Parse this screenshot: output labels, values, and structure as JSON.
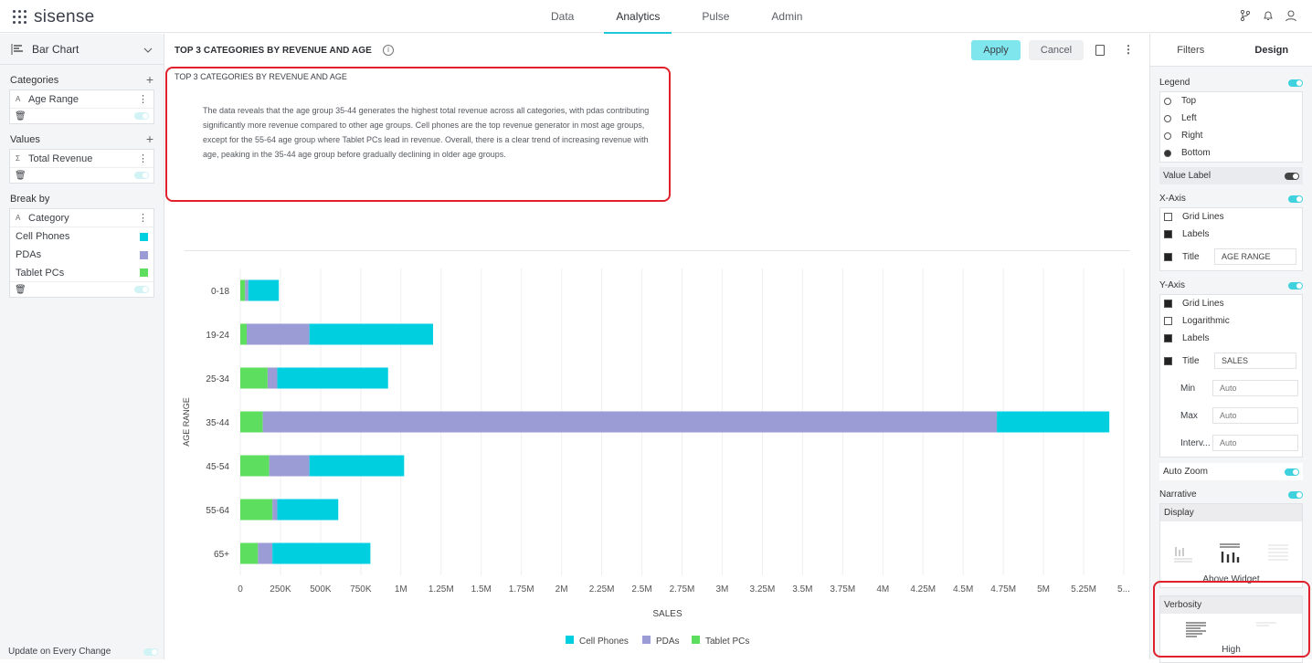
{
  "app": {
    "brand": "sisense"
  },
  "nav": [
    "Data",
    "Analytics",
    "Pulse",
    "Admin"
  ],
  "left": {
    "chart_type": "Bar Chart",
    "categories_label": "Categories",
    "categories_item": "Age Range",
    "values_label": "Values",
    "values_item": "Total Revenue",
    "breakby_label": "Break by",
    "breakby_item": "Category",
    "breakby_members": [
      {
        "name": "Cell Phones",
        "color": "#00cfe0"
      },
      {
        "name": "PDAs",
        "color": "#9b9bd6"
      },
      {
        "name": "Tablet PCs",
        "color": "#5ede5e"
      }
    ],
    "update_label": "Update on Every Change"
  },
  "main": {
    "title": "TOP 3 CATEGORIES BY REVENUE AND AGE",
    "apply": "Apply",
    "cancel": "Cancel",
    "narrative_title": "TOP 3 CATEGORIES BY REVENUE AND AGE",
    "narrative_text": "The data reveals that the age group 35-44 generates the highest total revenue across all categories, with pdas contributing significantly more revenue compared to other age groups. Cell phones are the top revenue generator in most age groups, except for the 55-64 age group where Tablet PCs lead in revenue. Overall, there is a clear trend of increasing revenue with age, peaking in the 35-44 age group before gradually declining in older age groups."
  },
  "chart_data": {
    "type": "bar",
    "orientation": "horizontal",
    "stacked": true,
    "categories": [
      "0-18",
      "19-24",
      "25-34",
      "35-44",
      "45-54",
      "55-64",
      "65+"
    ],
    "series": [
      {
        "name": "Tablet PCs",
        "color": "#5ede5e",
        "values": [
          30000,
          40000,
          170000,
          140000,
          180000,
          200000,
          110000
        ]
      },
      {
        "name": "PDAs",
        "color": "#9b9bd6",
        "values": [
          20000,
          390000,
          60000,
          4570000,
          250000,
          30000,
          90000
        ]
      },
      {
        "name": "Cell Phones",
        "color": "#00cfe0",
        "values": [
          190000,
          770000,
          690000,
          700000,
          590000,
          380000,
          610000
        ]
      }
    ],
    "x_ticks": [
      "0",
      "250K",
      "500K",
      "750K",
      "1M",
      "1.25M",
      "1.5M",
      "1.75M",
      "2M",
      "2.25M",
      "2.5M",
      "2.75M",
      "3M",
      "3.25M",
      "3.5M",
      "3.75M",
      "4M",
      "4.25M",
      "4.5M",
      "4.75M",
      "5M",
      "5.25M",
      "5..."
    ],
    "xlim": [
      0,
      5500000
    ],
    "xlabel": "SALES",
    "ylabel": "AGE RANGE",
    "legend": [
      "Cell Phones",
      "PDAs",
      "Tablet PCs"
    ],
    "legend_colors": [
      "#00cfe0",
      "#9b9bd6",
      "#5ede5e"
    ],
    "legend_position": "bottom",
    "grid": true
  },
  "right": {
    "tab_filters": "Filters",
    "tab_design": "Design",
    "legend_label": "Legend",
    "legend_options": [
      "Top",
      "Left",
      "Right",
      "Bottom"
    ],
    "legend_selected": "Bottom",
    "value_label": "Value Label",
    "xaxis_label": "X-Axis",
    "grid_lines": "Grid Lines",
    "labels": "Labels",
    "title": "Title",
    "xaxis_title": "AGE RANGE",
    "yaxis_label": "Y-Axis",
    "logarithmic": "Logarithmic",
    "yaxis_title": "SALES",
    "min": "Min",
    "max": "Max",
    "interval": "Interv...",
    "auto": "Auto",
    "auto_zoom": "Auto Zoom",
    "narrative": "Narrative",
    "display": "Display",
    "above_widget": "Above Widget",
    "verbosity": "Verbosity",
    "high": "High"
  }
}
